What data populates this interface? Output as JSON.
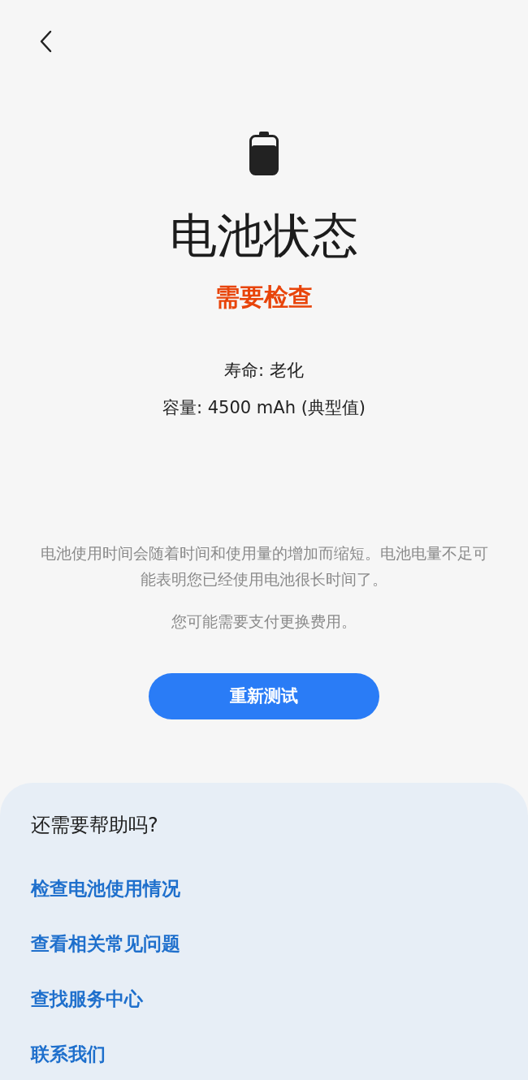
{
  "title": "电池状态",
  "status": "需要检查",
  "details": [
    "寿命: 老化",
    "容量: 4500 mAh (典型值)"
  ],
  "description": "电池使用时间会随着时间和使用量的增加而缩短。电池电量不足可能表明您已经使用电池很长时间了。",
  "note": "您可能需要支付更换费用。",
  "button": "重新测试",
  "help": {
    "heading": "还需要帮助吗?",
    "links": [
      "检查电池使用情况",
      "查看相关常见问题",
      "查找服务中心",
      "联系我们"
    ]
  }
}
